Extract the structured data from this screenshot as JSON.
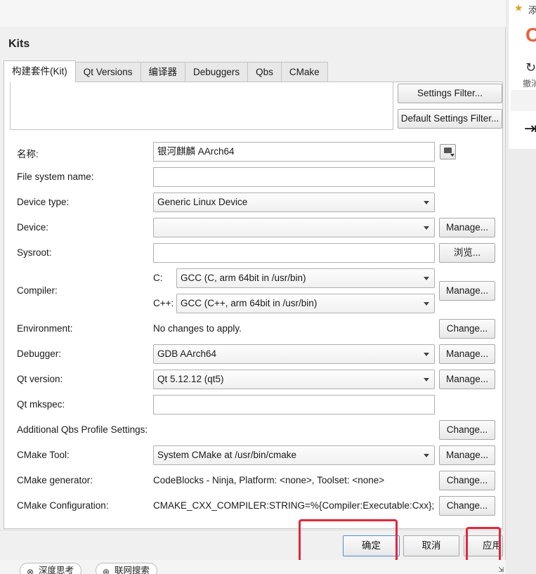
{
  "dialog": {
    "title": "Kits",
    "tabs": [
      {
        "label": "构建套件(Kit)",
        "active": true
      },
      {
        "label": "Qt Versions",
        "active": false
      },
      {
        "label": "编译器",
        "active": false
      },
      {
        "label": "Debuggers",
        "active": false
      },
      {
        "label": "Qbs",
        "active": false
      },
      {
        "label": "CMake",
        "active": false
      }
    ],
    "filters": {
      "settings_filter": "Settings Filter...",
      "default_settings_filter": "Default Settings Filter..."
    },
    "form": {
      "name": {
        "label": "名称:",
        "value": "银河麒麟 AArch64"
      },
      "file_system_name": {
        "label": "File system name:",
        "value": ""
      },
      "device_type": {
        "label": "Device type:",
        "value": "Generic Linux Device"
      },
      "device": {
        "label": "Device:",
        "value": "",
        "button": "Manage..."
      },
      "sysroot": {
        "label": "Sysroot:",
        "value": "",
        "button": "浏览..."
      },
      "compiler": {
        "label": "Compiler:",
        "c_label": "C:",
        "c_value": "GCC (C, arm 64bit in /usr/bin)",
        "cxx_label": "C++:",
        "cxx_value": "GCC (C++, arm 64bit in /usr/bin)",
        "button": "Manage..."
      },
      "environment": {
        "label": "Environment:",
        "value": "No changes to apply.",
        "button": "Change..."
      },
      "debugger": {
        "label": "Debugger:",
        "value": "GDB AArch64",
        "button": "Manage..."
      },
      "qt_version": {
        "label": "Qt version:",
        "value": "Qt 5.12.12 (qt5)",
        "button": "Manage..."
      },
      "qt_mkspec": {
        "label": "Qt mkspec:",
        "value": ""
      },
      "qbs_profile": {
        "label": "Additional Qbs Profile Settings:",
        "button": "Change..."
      },
      "cmake_tool": {
        "label": "CMake Tool:",
        "value": "System CMake at /usr/bin/cmake",
        "button": "Manage..."
      },
      "cmake_generator": {
        "label": "CMake generator:",
        "value": "CodeBlocks - Ninja, Platform: <none>, Toolset: <none>",
        "button": "Change..."
      },
      "cmake_configuration": {
        "label": "CMake Configuration:",
        "value": "CMAKE_CXX_COMPILER:STRING=%{Compiler:Executable:Cxx}; C…",
        "button": "Change..."
      }
    },
    "buttons": {
      "ok": "确定",
      "cancel": "取消",
      "apply": "应用"
    }
  },
  "right_panel": {
    "add_label": "添",
    "brand_letter": "C",
    "undo_label": "撤消"
  },
  "bottom_bar": {
    "deep_think": "深度思考",
    "web_search": "联网搜索"
  },
  "colors": {
    "highlight_box": "#e0283c",
    "brand": "#e5633b",
    "star": "#e0a21a"
  }
}
